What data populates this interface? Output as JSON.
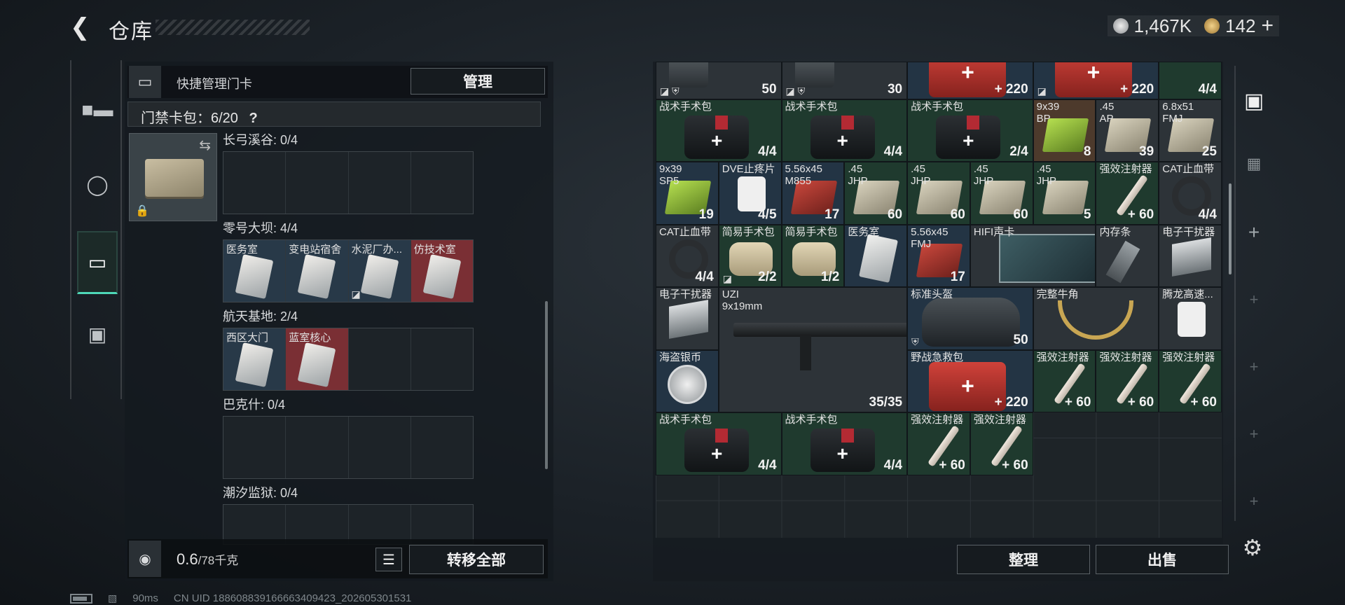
{
  "header": {
    "title": "仓库",
    "back_icon": "back-arrow-icon"
  },
  "currency": {
    "silver": "1,467K",
    "gold": "142",
    "gold_add": "+",
    "silver_color": "#c9ccce",
    "gold_color": "#d2a64a"
  },
  "left_nav": {
    "items": [
      "gun-icon",
      "armor-icon",
      "keycard-icon",
      "toolbox-icon"
    ],
    "active": 2
  },
  "keycards": {
    "header_label": "快捷管理门卡",
    "manage_label": "管理",
    "count_label": "门禁卡包：6/20",
    "help": "?",
    "groups": [
      {
        "title": "长弓溪谷: 0/4",
        "slots": [
          "",
          "",
          "",
          ""
        ]
      },
      {
        "title": "零号大坝: 4/4",
        "slots": [
          "医务室",
          "变电站宿舍",
          "水泥厂办...",
          "仿技术室"
        ]
      },
      {
        "title": "航天基地: 2/4",
        "slots": [
          "西区大门",
          "蓝室核心",
          "",
          ""
        ]
      },
      {
        "title": "巴克什: 0/4",
        "slots": [
          "",
          "",
          "",
          ""
        ]
      },
      {
        "title": "潮汐监狱: 0/4",
        "slots": [
          "",
          "",
          "",
          ""
        ]
      }
    ]
  },
  "footer_left": {
    "weight": "0.6",
    "weight_max": "/78千克",
    "transfer_label": "转移全部"
  },
  "status": {
    "ping": "90ms",
    "uid": "CN UID 1886088391666634​09423_202605301531"
  },
  "stash": {
    "items": [
      {
        "name": "",
        "count": "50",
        "icon": "◪ ⛨"
      },
      {
        "name": "",
        "count": "30",
        "icon": "◪ ⛨"
      },
      {
        "name": "",
        "count": "+ 220"
      },
      {
        "name": "",
        "count": "+ 220",
        "icon": "◪"
      },
      {
        "name": "",
        "count": "4/4"
      },
      {
        "name": "战术手术包",
        "count": "4/4"
      },
      {
        "name": "战术手术包",
        "count": "4/4"
      },
      {
        "name": "战术手术包",
        "count": "2/4"
      },
      {
        "name": "9x39\nBP",
        "count": "8"
      },
      {
        "name": ".45\nAP",
        "count": "39"
      },
      {
        "name": "6.8x51\nFMJ",
        "count": "25"
      },
      {
        "name": "9x39\nSP5",
        "count": "19"
      },
      {
        "name": "DVE止疼片",
        "count": "4/5"
      },
      {
        "name": "5.56x45\nM855",
        "count": "17"
      },
      {
        "name": ".45\nJHP",
        "count": "60"
      },
      {
        "name": ".45\nJHP",
        "count": "60"
      },
      {
        "name": ".45\nJHP",
        "count": "60"
      },
      {
        "name": ".45\nJHP",
        "count": "5"
      },
      {
        "name": "强效注射器",
        "count": "+ 60"
      },
      {
        "name": "CAT止血带",
        "count": "4/4"
      },
      {
        "name": "CAT止血带",
        "count": "4/4"
      },
      {
        "name": "简易手术包",
        "count": "2/2",
        "icon": "◪"
      },
      {
        "name": "简易手术包",
        "count": "1/2"
      },
      {
        "name": "医务室",
        "count": ""
      },
      {
        "name": "5.56x45\nFMJ",
        "count": "17"
      },
      {
        "name": "HIFI声卡",
        "count": ""
      },
      {
        "name": "内存条",
        "count": ""
      },
      {
        "name": "电子干扰器",
        "count": ""
      },
      {
        "name": "电子干扰器",
        "count": ""
      },
      {
        "name": "UZI\n9x19mm",
        "count": "35/35"
      },
      {
        "name": "标准头盔",
        "count": "50",
        "icon": "⛨"
      },
      {
        "name": "完整牛角",
        "count": ""
      },
      {
        "name": "腾龙高速...",
        "count": ""
      },
      {
        "name": "海盗银币",
        "count": ""
      },
      {
        "name": "野战急救包",
        "count": "+ 220"
      },
      {
        "name": "强效注射器",
        "count": "+ 60"
      },
      {
        "name": "强效注射器",
        "count": "+ 60"
      },
      {
        "name": "强效注射器",
        "count": "+ 60"
      },
      {
        "name": "战术手术包",
        "count": "4/4"
      },
      {
        "name": "战术手术包",
        "count": "4/4"
      },
      {
        "name": "强效注射器",
        "count": "+ 60"
      },
      {
        "name": "强效注射器",
        "count": "+ 60"
      }
    ],
    "arrange_label": "整理",
    "sell_label": "出售"
  },
  "right_nav": {
    "items": [
      "backpack-icon",
      "stash-icon",
      "+",
      "+",
      "+",
      "+",
      "+"
    ]
  }
}
